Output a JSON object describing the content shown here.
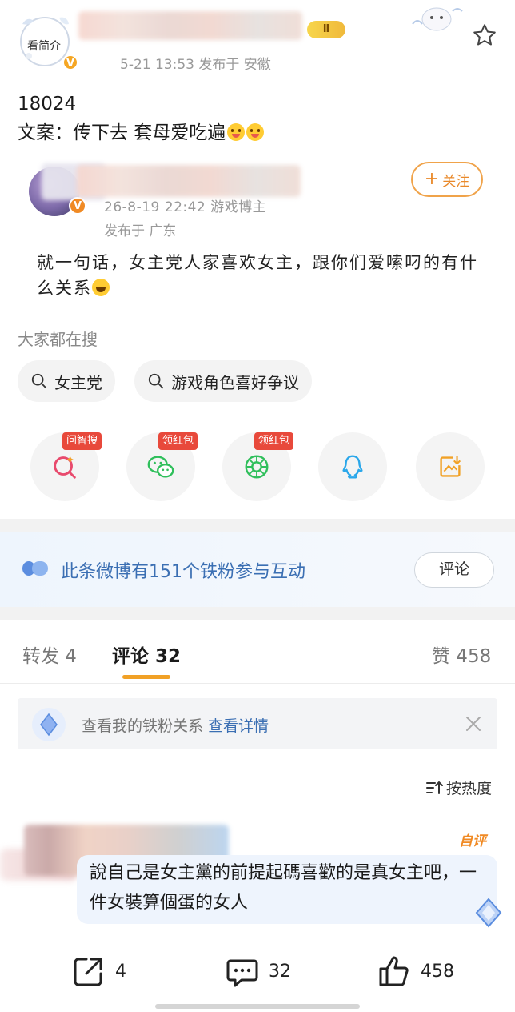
{
  "header": {
    "intro_label": "看简介",
    "post_meta": "5-21 13:53 发布于 安徽",
    "level_badge": "Ⅱ"
  },
  "post": {
    "line1": "18024",
    "line2": "文案：传下去 套母爱吃遍"
  },
  "quoted": {
    "meta": "26-8-19 22:42  游戏博主",
    "location": "发布于 广东",
    "follow_label": "关注",
    "text": "就一句话，女主党人家喜欢女主，跟你们爱嗦叼的有什么关系"
  },
  "search": {
    "heading": "大家都在搜",
    "chips": [
      "女主党",
      "游戏角色喜好争议"
    ]
  },
  "share": {
    "tags": [
      "问智搜",
      "领红包",
      "领红包"
    ],
    "icons": [
      "ai-search-icon",
      "wechat-icon",
      "moments-icon",
      "qq-icon",
      "save-image-icon"
    ]
  },
  "fans": {
    "banner_text": "此条微博有151个铁粉参与互动",
    "comment_button": "评论"
  },
  "tabs": {
    "repost": "转发 4",
    "comment": "评论 32",
    "like": "赞 458"
  },
  "relation": {
    "text": "查看我的铁粉关系",
    "link": "查看详情"
  },
  "sort": {
    "label": "按热度"
  },
  "comment": {
    "tag": "自评",
    "text": "說自己是女主黨的前提起碼喜歡的是真女主吧，一件女裝算個蛋的女人"
  },
  "actions": {
    "repost_count": "4",
    "comment_count": "32",
    "like_count": "458"
  },
  "colors": {
    "accent": "#f1a126",
    "link_blue": "#3b6fb3",
    "tag_red": "#e8493b"
  }
}
